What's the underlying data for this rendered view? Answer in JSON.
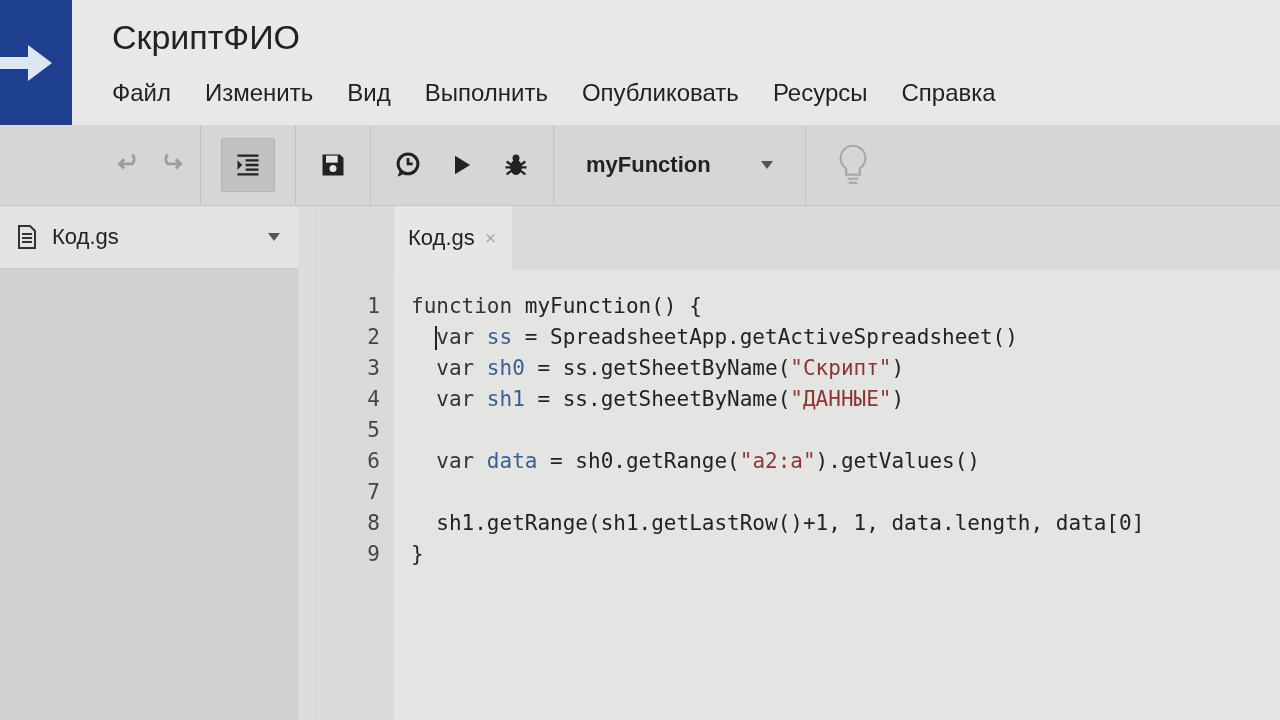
{
  "header": {
    "title": "СкриптФИО",
    "menu": [
      "Файл",
      "Изменить",
      "Вид",
      "Выполнить",
      "Опубликовать",
      "Ресурсы",
      "Справка"
    ]
  },
  "toolbar": {
    "buttons": [
      {
        "kind": "undo",
        "disabled": true,
        "pressed": false
      },
      {
        "kind": "redo",
        "disabled": true,
        "pressed": false
      },
      {
        "kind": "indent",
        "disabled": false,
        "pressed": true
      },
      {
        "kind": "save",
        "disabled": false,
        "pressed": false
      },
      {
        "kind": "clock",
        "disabled": false,
        "pressed": false
      },
      {
        "kind": "run",
        "disabled": false,
        "pressed": false
      },
      {
        "kind": "debug",
        "disabled": false,
        "pressed": false
      }
    ],
    "function_select": "myFunction",
    "hint_disabled": true
  },
  "sidebar": {
    "files": [
      {
        "name": "Код.gs",
        "selected": true
      }
    ]
  },
  "tabs": [
    {
      "label": "Код.gs",
      "close": "×",
      "selected": true
    }
  ],
  "editor": {
    "lines": [
      {
        "number": "1",
        "cursor": false,
        "tokens": [
          {
            "kind": "keyword",
            "text": "function"
          },
          {
            "kind": "plain",
            "text": " myFunction() {"
          }
        ]
      },
      {
        "number": "2",
        "cursor": true,
        "tokens": [
          {
            "kind": "keyword",
            "text": "  var"
          },
          {
            "kind": "def",
            "text": " ss"
          },
          {
            "kind": "plain",
            "text": " = SpreadsheetApp.getActiveSpreadsheet()"
          }
        ]
      },
      {
        "number": "3",
        "cursor": false,
        "tokens": [
          {
            "kind": "keyword",
            "text": "  var"
          },
          {
            "kind": "def",
            "text": " sh0"
          },
          {
            "kind": "plain",
            "text": " = ss.getSheetByName("
          },
          {
            "kind": "string",
            "text": "\"Скрипт\""
          },
          {
            "kind": "plain",
            "text": ")"
          }
        ]
      },
      {
        "number": "4",
        "cursor": false,
        "tokens": [
          {
            "kind": "keyword",
            "text": "  var"
          },
          {
            "kind": "def",
            "text": " sh1"
          },
          {
            "kind": "plain",
            "text": " = ss.getSheetByName("
          },
          {
            "kind": "string",
            "text": "\"ДАННЫЕ\""
          },
          {
            "kind": "plain",
            "text": ")"
          }
        ]
      },
      {
        "number": "5",
        "cursor": false
      },
      {
        "number": "6",
        "cursor": false,
        "tokens": [
          {
            "kind": "keyword",
            "text": "  var"
          },
          {
            "kind": "def",
            "text": " data"
          },
          {
            "kind": "plain",
            "text": " = sh0.getRange("
          },
          {
            "kind": "string",
            "text": "\"a2:a\""
          },
          {
            "kind": "plain",
            "text": ").getValues()"
          }
        ]
      },
      {
        "number": "7",
        "cursor": false
      },
      {
        "number": "8",
        "cursor": false,
        "tokens": [
          {
            "kind": "plain",
            "text": "  sh1.getRange(sh1.getLastRow()+1, 1, data.length, data[0]"
          }
        ]
      },
      {
        "number": "9",
        "cursor": false,
        "tokens": [
          {
            "kind": "plain",
            "text": "}"
          }
        ]
      }
    ]
  }
}
